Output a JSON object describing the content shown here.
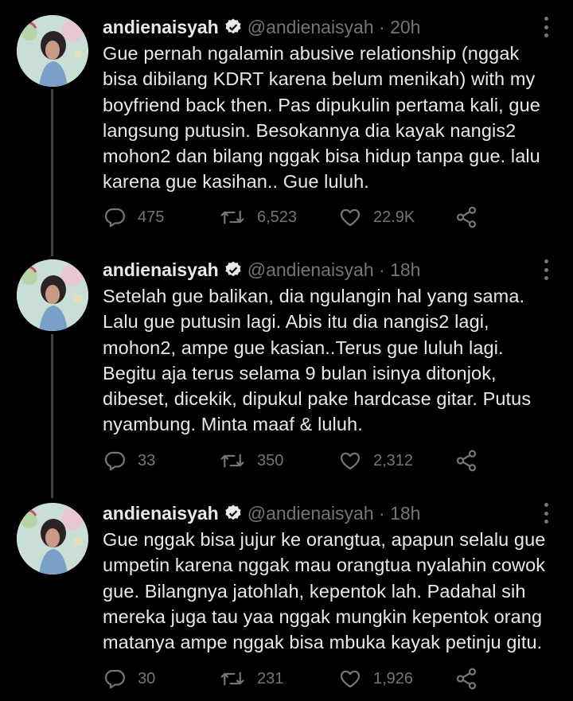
{
  "tweets": [
    {
      "name": "andienaisyah",
      "handle": "@andienaisyah",
      "separator": "·",
      "time": "20h",
      "lines": [
        "Gue pernah ngalamin abusive relationship (nggak",
        "bisa dibilang KDRT karena belum menikah) with my",
        "boyfriend back then. Pas dipukulin pertama kali, gue",
        "langsung putusin. Besokannya dia kayak nangis2",
        "mohon2 dan bilang nggak bisa hidup tanpa gue. lalu",
        "karena gue kasihan.. Gue luluh."
      ],
      "replies": "475",
      "retweets": "6,523",
      "likes": "22.9K"
    },
    {
      "name": "andienaisyah",
      "handle": "@andienaisyah",
      "separator": "·",
      "time": "18h",
      "lines": [
        "Setelah gue balikan, dia ngulangin hal yang sama.",
        "Lalu gue putusin lagi. Abis itu dia nangis2 lagi,",
        "mohon2, ampe gue kasian..Terus gue luluh lagi.",
        "Begitu aja terus selama 9 bulan isinya ditonjok,",
        "dibeset, dicekik, dipukul pake hardcase gitar. Putus",
        "nyambung. Minta maaf & luluh."
      ],
      "replies": "33",
      "retweets": "350",
      "likes": "2,312"
    },
    {
      "name": "andienaisyah",
      "handle": "@andienaisyah",
      "separator": "·",
      "time": "18h",
      "lines": [
        "Gue nggak bisa jujur ke orangtua, apapun selalu gue",
        "umpetin karena nggak mau orangtua nyalahin cowok",
        "gue. Bilangnya jatohlah, kepentok lah. Padahal sih",
        "mereka juga tau yaa nggak mungkin kepentok orang",
        "matanya ampe nggak bisa mbuka kayak petinju gitu."
      ],
      "replies": "30",
      "retweets": "231",
      "likes": "1,926"
    }
  ],
  "icons": [
    "verified-badge-icon",
    "more-icon",
    "reply-icon",
    "retweet-icon",
    "like-icon",
    "share-icon"
  ],
  "colors": {
    "background": "#000000",
    "text": "#e7e9ea",
    "secondary": "#71767b",
    "thread_line": "#3d4145"
  }
}
